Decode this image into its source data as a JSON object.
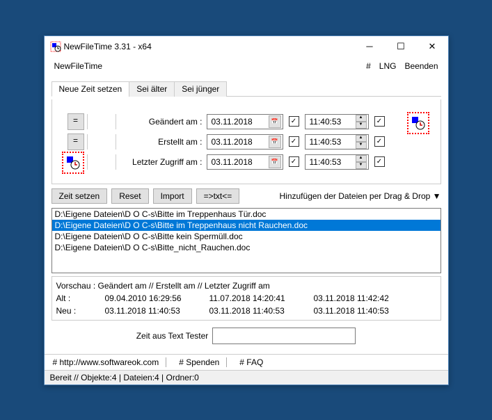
{
  "window": {
    "title": "NewFileTime 3.31 - x64"
  },
  "menubar": {
    "left": "NewFileTime",
    "hash": "#",
    "lng": "LNG",
    "exit": "Beenden"
  },
  "tabs": {
    "t1": "Neue Zeit setzen",
    "t2": "Sei älter",
    "t3": "Sei jünger"
  },
  "labels": {
    "modified": "Geändert am :",
    "created": "Erstellt am :",
    "accessed": "Letzter Zugriff am :"
  },
  "date": {
    "d1": "03.11.2018",
    "d2": "03.11.2018",
    "d3": "03.11.2018"
  },
  "time": {
    "t1": "11:40:53",
    "t2": "11:40:53",
    "t3": "11:40:53"
  },
  "eq": "=",
  "buttons": {
    "set": "Zeit setzen",
    "reset": "Reset",
    "import": "Import",
    "txt": "=>txt<="
  },
  "dragdrop": "Hinzufügen der Dateien per Drag & Drop  ▼",
  "files": {
    "f0": "D:\\Eigene Dateien\\D O C-s\\Bitte im Treppenhaus Tür.doc",
    "f1": "D:\\Eigene Dateien\\D O C-s\\Bitte im Treppenhaus nicht Rauchen.doc",
    "f2": "D:\\Eigene Dateien\\D O C-s\\Bitte kein Spermüll.doc",
    "f3": "D:\\Eigene Dateien\\D O C-s\\Bitte_nicht_Rauchen.doc"
  },
  "preview": {
    "header": "Vorschau  :   Geändert am     //    Erstellt am    //    Letzter Zugriff am",
    "old_label": "Alt :",
    "new_label": "Neu :",
    "old": {
      "c1": "09.04.2010 16:29:56",
      "c2": "11.07.2018 14:20:41",
      "c3": "03.11.2018 11:42:42"
    },
    "new": {
      "c1": "03.11.2018 11:40:53",
      "c2": "03.11.2018 11:40:53",
      "c3": "03.11.2018 11:40:53"
    }
  },
  "tester_label": "Zeit aus Text Tester",
  "footer": {
    "url": "# http://www.softwareok.com",
    "donate": "# Spenden",
    "faq": "# FAQ"
  },
  "status": "Bereit // Objekte:4 | Dateien:4 | Ordner:0",
  "check": "✓",
  "down": "▼",
  "up": "▲",
  "dn": "▼"
}
